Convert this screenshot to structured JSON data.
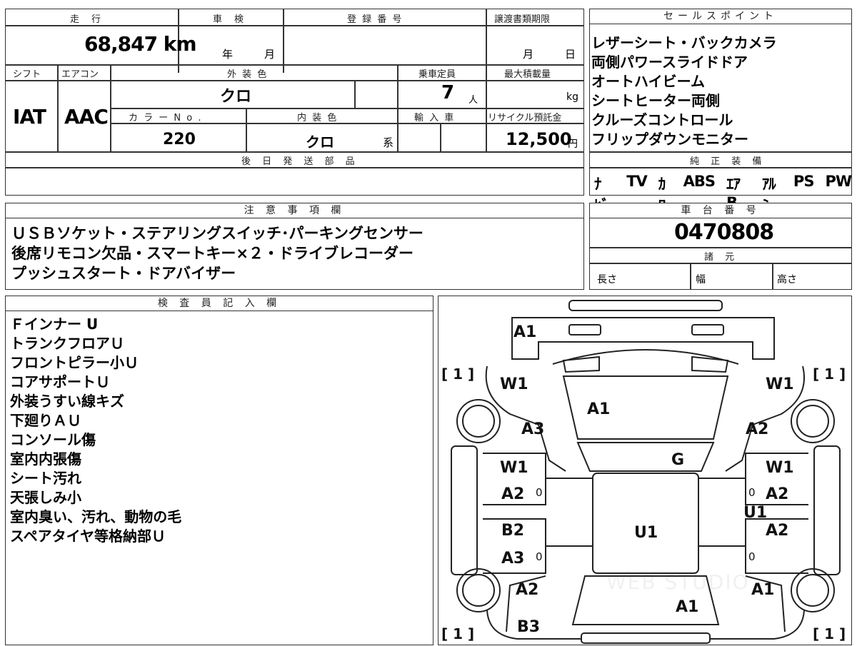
{
  "top_table": {
    "headers": {
      "mileage": "走　行",
      "inspection": "車　検",
      "registration": "登 録 番 号",
      "transfer_deadline": "譲渡書類期限",
      "shift": "シフト",
      "aircon": "エアコン",
      "exterior_color": "外 装 色",
      "capacity": "乗車定員",
      "max_load": "最大積載量",
      "color_no": "カ ラ ー N o .",
      "interior_color": "内 装 色",
      "import": "輸 入 車",
      "recycle_fee": "リサイクル預託金",
      "later_parts": "後 日 発 送 部 品"
    },
    "values": {
      "mileage": "68,847 km",
      "inspection_year": "年",
      "inspection_month": "月",
      "transfer_month": "月",
      "transfer_day": "日",
      "shift": "IAT",
      "aircon": "AAC",
      "exterior_color": "クロ",
      "capacity": "7",
      "capacity_unit": "人",
      "max_load_unit": "kg",
      "color_no": "220",
      "interior_color": "クロ",
      "interior_suffix": "系",
      "recycle_fee": "12,500",
      "recycle_unit": "円"
    }
  },
  "sales_points": {
    "title": "セールスポイント",
    "items": [
      "レザーシート・バックカメラ",
      "両側パワースライドドア",
      "オートハイビーム",
      "シートヒーター両側",
      "クルーズコントロール",
      "フリップダウンモニター"
    ]
  },
  "genuine_equipment": {
    "title": "純 正 装 備",
    "items": [
      "ﾅﾋﾞ",
      "TV",
      "ｶﾜ",
      "ABS",
      "ｴｱB",
      "ｱﾙﾐ",
      "PS",
      "PW"
    ]
  },
  "notes": {
    "title": "注 意 事 項 欄",
    "lines": [
      "ＵＳＢソケット・ステアリングスイッチ･パーキングセンサー",
      "後席リモコン欠品・スマートキー×２・ドライブレコーダー",
      "プッシュスタート・ドアバイザー"
    ]
  },
  "chassis": {
    "title": "車 台 番 号",
    "number": "0470808",
    "specs_title": "諸 元",
    "length": "長さ",
    "width": "幅",
    "height": "高さ"
  },
  "inspector": {
    "title": "検 査 員 記 入 欄",
    "lines": [
      "Ｆインナー U",
      "トランクフロアＵ",
      "フロントピラー小Ｕ",
      "コアサポートＵ",
      "外装うすい線キズ",
      "下廻りＡＵ",
      "コンソール傷",
      "室内内張傷",
      "シート汚れ",
      "天張しみ小",
      "室内臭い、汚れ、動物の毛",
      "スペアタイヤ等格納部Ｕ"
    ]
  },
  "diagram": {
    "labels": {
      "front": "A1",
      "hood": "A1",
      "windshield": "G",
      "roof": "U1",
      "rear": "A1",
      "right_rear_center": "U1",
      "lf_fender_w": "W1",
      "lf_fender_a": "A3",
      "rf_fender_w": "W1",
      "rf_fender_a": "A2",
      "lf_door_w": "W1",
      "lf_door_a": "A2",
      "rf_door_w": "W1",
      "rf_door_a": "A2",
      "lr_door_b": "B2",
      "lr_door_a": "A3",
      "rr_door_a": "A2",
      "lr_quarter": "A2",
      "lr_lower": "B3",
      "rr_quarter": "A1",
      "tire_lf": "[ 1 ]",
      "tire_rf": "[ 1 ]",
      "tire_lr": "[ 1 ]",
      "tire_rr": "[ 1 ]"
    },
    "zeros": [
      "0",
      "0",
      "0",
      "0"
    ],
    "watermark": "WEB STUDIO"
  }
}
